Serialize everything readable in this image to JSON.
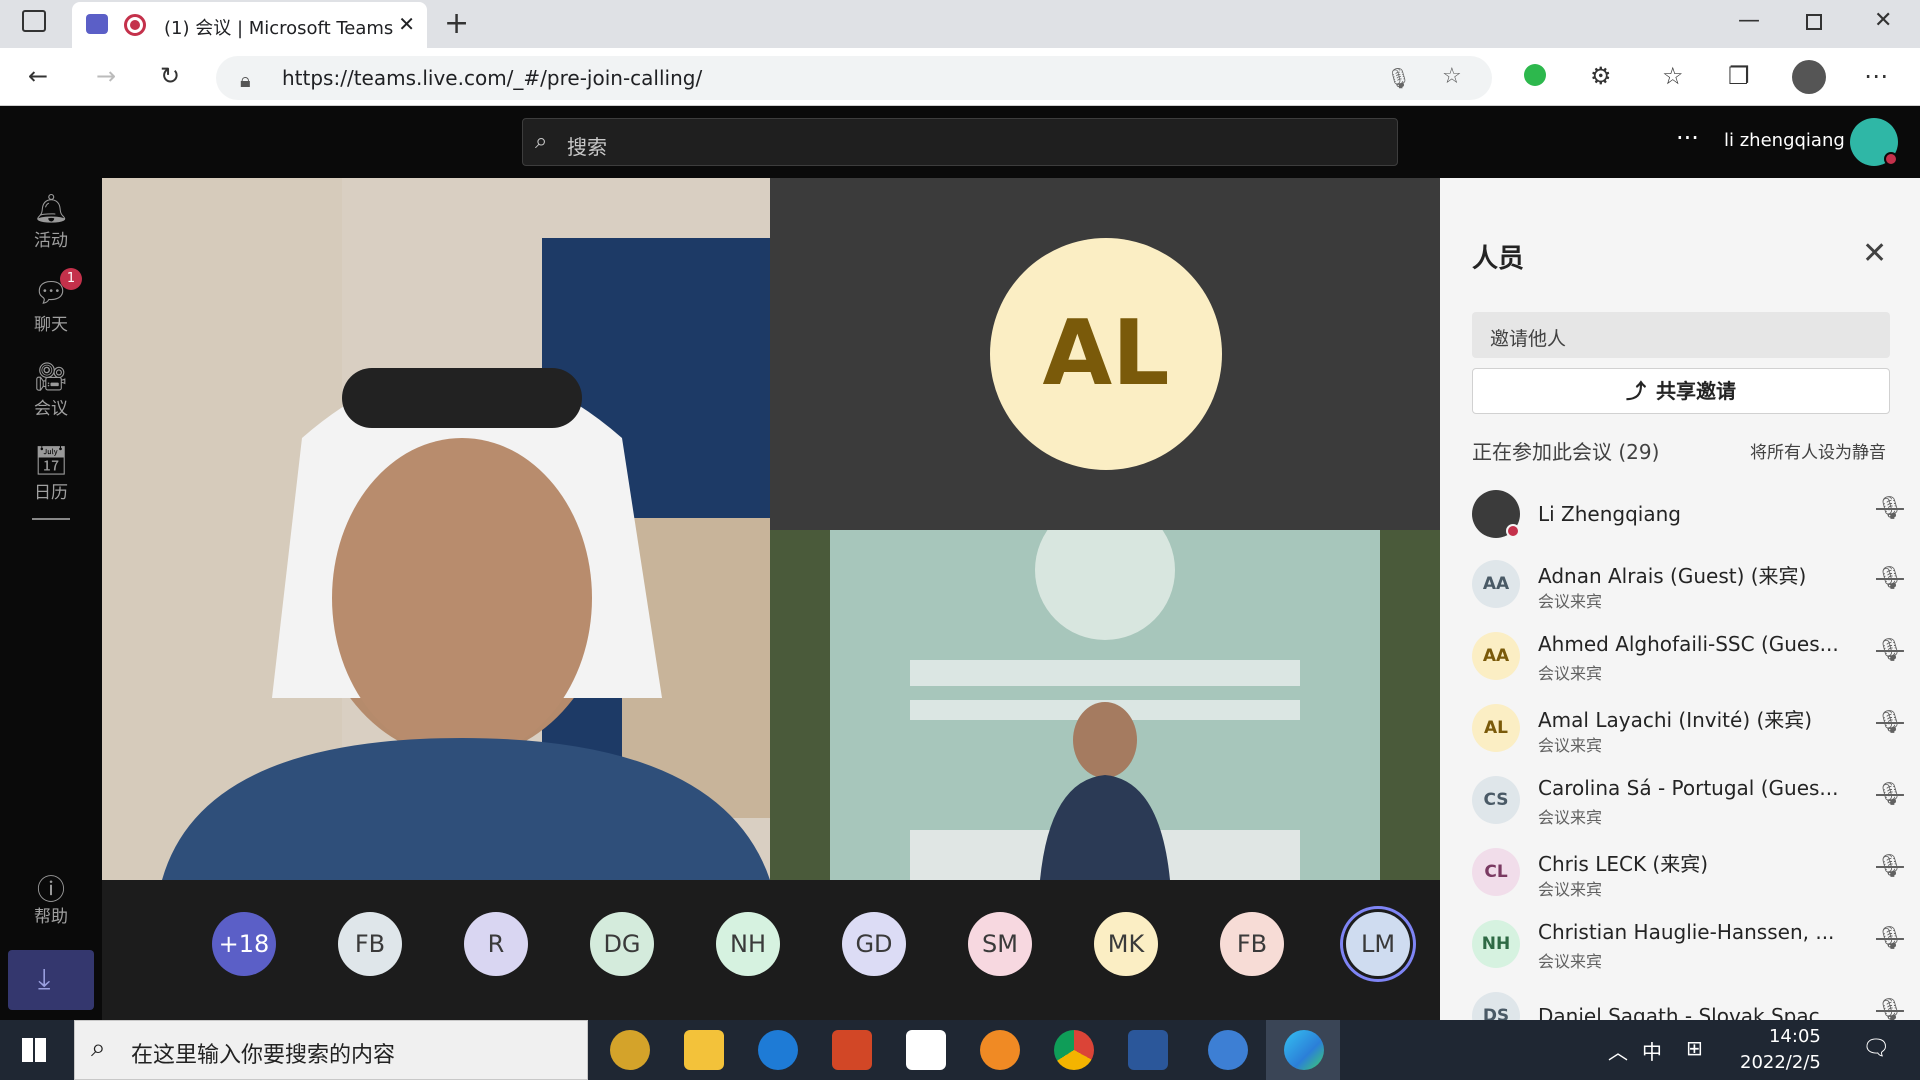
{
  "browser": {
    "tab_title": "(1) 会议 | Microsoft Teams",
    "url": "https://teams.live.com/_#/pre-join-calling/"
  },
  "teams": {
    "search_placeholder": "搜索",
    "user_name": "li zhengqiang",
    "rail": [
      {
        "label": "活动",
        "icon": "bell-icon"
      },
      {
        "label": "聊天",
        "icon": "chat-icon",
        "badge": "1"
      },
      {
        "label": "会议",
        "icon": "video-icon"
      },
      {
        "label": "日历",
        "icon": "calendar-icon"
      }
    ],
    "help_label": "帮助"
  },
  "stage": {
    "tile_initials": "AL",
    "avatars": [
      {
        "initials": "+18",
        "color": "#5b5fc7",
        "fg": "#ffffff"
      },
      {
        "initials": "FB",
        "color": "#dfe6ea",
        "fg": "#3a3a3a"
      },
      {
        "initials": "R",
        "color": "#d9d6f2",
        "fg": "#3a3a3a"
      },
      {
        "initials": "DG",
        "color": "#d4ebdc",
        "fg": "#3a3a3a"
      },
      {
        "initials": "NH",
        "color": "#d6f2e0",
        "fg": "#3a3a3a"
      },
      {
        "initials": "GD",
        "color": "#dcdcf5",
        "fg": "#3a3a3a"
      },
      {
        "initials": "SM",
        "color": "#f7d8e0",
        "fg": "#3a3a3a"
      },
      {
        "initials": "MK",
        "color": "#fbeec4",
        "fg": "#3a3a3a"
      },
      {
        "initials": "FB",
        "color": "#f7dcd6",
        "fg": "#3a3a3a"
      },
      {
        "initials": "LM",
        "color": "#cfdcf0",
        "fg": "#3a3a3a"
      }
    ]
  },
  "people": {
    "title": "人员",
    "invite_placeholder": "邀请他人",
    "share_label": "共享邀请",
    "section_label": "正在参加此会议 (29)",
    "mute_all_label": "将所有人设为静音",
    "participants": [
      {
        "initials": "",
        "name": "Li Zhengqiang",
        "role": "",
        "color": "#3b3b3b",
        "fg": "#ffffff"
      },
      {
        "initials": "AA",
        "name": "Adnan Alrais (Guest) (来宾)",
        "role": "会议来宾",
        "color": "#dfe6ea",
        "fg": "#4a5a66"
      },
      {
        "initials": "AA",
        "name": "Ahmed Alghofaili-SSC (Gues...",
        "role": "会议来宾",
        "color": "#fbeec4",
        "fg": "#7a5a0a"
      },
      {
        "initials": "AL",
        "name": "Amal Layachi (Invité) (来宾)",
        "role": "会议来宾",
        "color": "#fbeec4",
        "fg": "#7a5a0a"
      },
      {
        "initials": "CS",
        "name": "Carolina Sá - Portugal (Gues...",
        "role": "会议来宾",
        "color": "#dfe6ea",
        "fg": "#4a5a66"
      },
      {
        "initials": "CL",
        "name": "Chris LECK (来宾)",
        "role": "会议来宾",
        "color": "#f1ddea",
        "fg": "#7a3a62"
      },
      {
        "initials": "NH",
        "name": "Christian Hauglie-Hanssen, ...",
        "role": "会议来宾",
        "color": "#d6f2e0",
        "fg": "#2f6a45"
      },
      {
        "initials": "DS",
        "name": "Daniel Sagath - Slovak Spac...",
        "role": "",
        "color": "#dfe6ea",
        "fg": "#4a5a66"
      }
    ]
  },
  "taskbar": {
    "search_placeholder": "在这里输入你要搜索的内容",
    "ime": "中",
    "time": "14:05",
    "date": "2022/2/5"
  }
}
